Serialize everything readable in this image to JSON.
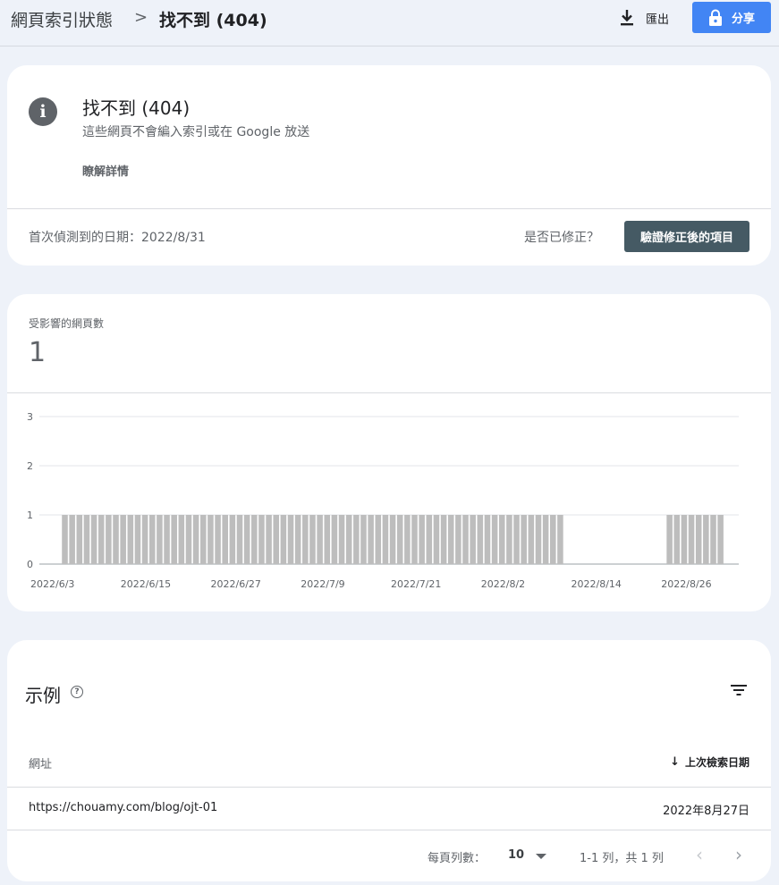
{
  "breadcrumb": {
    "root": "網頁索引狀態",
    "separator": ">",
    "current": "找不到 (404)"
  },
  "toolbar": {
    "export_label": "匯出",
    "export_icon": "download-icon",
    "share_label": "分享",
    "share_icon": "lock-icon",
    "share_color": "#4285f4"
  },
  "issue": {
    "icon": "info-icon",
    "title": "找不到 (404)",
    "subtitle": "這些網頁不會編入索引或在 Google 放送",
    "learn_more": "瞭解詳情",
    "first_detected": "首次偵測到的日期：2022/8/31",
    "fixed_question": "是否已修正？",
    "validate_button": "驗證修正後的項目",
    "validate_color": "#455a64"
  },
  "affected": {
    "label": "受影響的網頁數",
    "count": "1"
  },
  "chart_data": {
    "type": "bar",
    "start_date": "2022/6/3",
    "x_ticks": [
      "2022/6/3",
      "2022/6/15",
      "2022/6/27",
      "2022/7/9",
      "2022/7/21",
      "2022/8/2",
      "2022/8/14",
      "2022/8/26"
    ],
    "y_ticks": [
      0,
      1,
      2,
      3
    ],
    "ylim": [
      0,
      3
    ],
    "bar_color": "#bdbdbd",
    "grid": true,
    "values": [
      0,
      0,
      0,
      1,
      1,
      1,
      1,
      1,
      1,
      1,
      1,
      1,
      1,
      1,
      1,
      1,
      1,
      1,
      1,
      1,
      1,
      1,
      1,
      1,
      1,
      1,
      1,
      1,
      1,
      1,
      1,
      1,
      1,
      1,
      1,
      1,
      1,
      1,
      1,
      1,
      1,
      1,
      1,
      1,
      1,
      1,
      1,
      1,
      1,
      1,
      1,
      1,
      1,
      1,
      1,
      1,
      1,
      1,
      1,
      1,
      1,
      1,
      1,
      1,
      1,
      1,
      1,
      1,
      1,
      1,
      1,
      1,
      0,
      0,
      0,
      0,
      0,
      0,
      0,
      0,
      0,
      0,
      0,
      0,
      0,
      0,
      1,
      1,
      1,
      1,
      1,
      1,
      1,
      1,
      0,
      0
    ]
  },
  "examples": {
    "title": "示例",
    "help_icon": "help-icon",
    "filter_icon": "filter-icon",
    "columns": {
      "url": "網址",
      "date": "上次檢索日期",
      "sort_icon": "arrow-down-icon"
    },
    "rows": [
      {
        "url": "https://chouamy.com/blog/ojt-01",
        "date": "2022年8月27日"
      }
    ],
    "rows_per_page_label": "每頁列數：",
    "rows_per_page": "10",
    "page_info": "1-1 列，共 1 列"
  }
}
